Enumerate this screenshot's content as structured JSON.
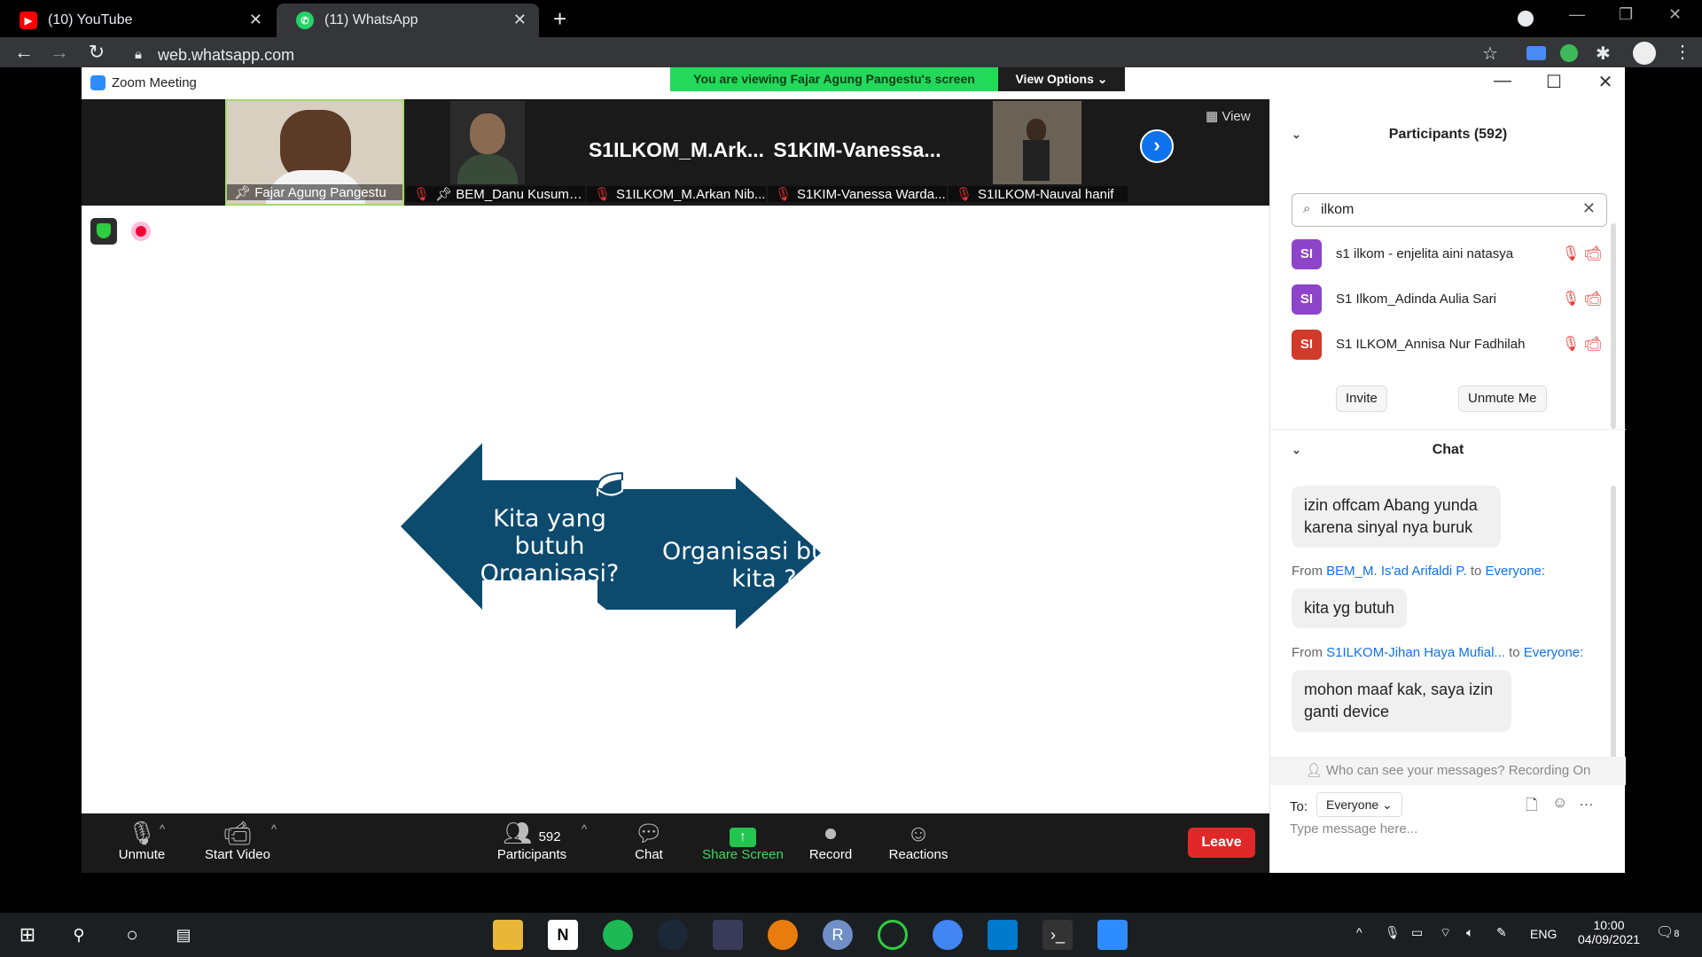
{
  "browser": {
    "tabs": [
      {
        "label": "(10) YouTube",
        "active": false
      },
      {
        "label": "(11) WhatsApp",
        "active": true
      }
    ],
    "url": "web.whatsapp.com"
  },
  "zoom": {
    "window_title": "Zoom Meeting",
    "banner": "You are viewing Fajar Agung Pangestu's screen",
    "view_options": "View Options",
    "view_label": "View",
    "thumbnails": [
      {
        "name": "Fajar Agung Pangestu",
        "big": ""
      },
      {
        "name": "BEM_Danu Kusuma...",
        "big": ""
      },
      {
        "name": "S1ILKOM_M.Arkan Nib...",
        "big": "S1ILKOM_M.Ark..."
      },
      {
        "name": "S1KIM-Vanessa Warda...",
        "big": "S1KIM-Vanessa..."
      },
      {
        "name": "S1ILKOM-Nauval hanif",
        "big": ""
      }
    ],
    "slide": {
      "left_text": "Kita yang butuh Organisasi?",
      "right_text": "Organisasi butuh kita ?"
    },
    "toolbar": {
      "unmute": "Unmute",
      "start_video": "Start Video",
      "participants": "Participants",
      "participant_count": "592",
      "chat": "Chat",
      "share_screen": "Share Screen",
      "record": "Record",
      "reactions": "Reactions",
      "leave": "Leave"
    },
    "participants_panel": {
      "title": "Participants (592)",
      "search_value": "ilkom",
      "rows": [
        {
          "initials": "SI",
          "name": "s1 ilkom - enjelita aini natasya",
          "color": "#8e44c9"
        },
        {
          "initials": "SI",
          "name": "S1 Ilkom_Adinda Aulia Sari",
          "color": "#8e44c9"
        },
        {
          "initials": "SI",
          "name": "S1 ILKOM_Annisa Nur Fadhilah",
          "color": "#d23a2a"
        }
      ],
      "invite": "Invite",
      "unmute_me": "Unmute Me"
    },
    "chat_panel": {
      "title": "Chat",
      "messages": [
        {
          "from": "",
          "to": "",
          "text": "izin offcam Abang yunda karena sinyal nya buruk"
        },
        {
          "from": "BEM_M. Is'ad Arifaldi P.",
          "to": "Everyone:",
          "text": "kita yg butuh"
        },
        {
          "from": "S1ILKOM-Jihan Haya Mufial...",
          "to": "Everyone:",
          "text": "mohon maaf kak, saya izin ganti device"
        }
      ],
      "from_prefix": "From",
      "to_word": "to",
      "recording_note": "Who can see your messages? Recording On",
      "to_label": "To:",
      "to_value": "Everyone",
      "placeholder": "Type message here..."
    }
  },
  "taskbar": {
    "lang": "ENG",
    "time": "10:00",
    "date": "04/09/2021",
    "notif_count": "8"
  },
  "colors": {
    "zoom_blue": "#0e72ed",
    "slide_navy": "#0c4a6e",
    "leave_red": "#e02828",
    "banner_green": "#23d959"
  }
}
